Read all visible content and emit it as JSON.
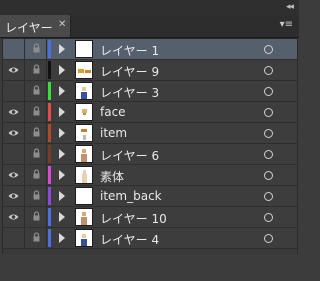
{
  "panel": {
    "collapse_glyph": "◂◂",
    "tab_label": "レイヤー",
    "close_glyph": "✕",
    "menu_glyph": "▾≡"
  },
  "layers": [
    {
      "name": "レイヤー 1",
      "visible": false,
      "color": "#4f6ee0",
      "selected": true,
      "thumb": "blank"
    },
    {
      "name": "レイヤー 9",
      "visible": true,
      "color": "#111111",
      "selected": false,
      "thumb": "objects"
    },
    {
      "name": "レイヤー 3",
      "visible": false,
      "color": "#3ddc3d",
      "selected": false,
      "thumb": "figure-blue"
    },
    {
      "name": "face",
      "visible": true,
      "color": "#e64a4a",
      "selected": false,
      "thumb": "face"
    },
    {
      "name": "item",
      "visible": true,
      "color": "#b04a2a",
      "selected": false,
      "thumb": "item"
    },
    {
      "name": "レイヤー 6",
      "visible": false,
      "color": "#7a3c2a",
      "selected": false,
      "thumb": "figure"
    },
    {
      "name": "素体",
      "visible": true,
      "color": "#d64ad6",
      "selected": false,
      "thumb": "body"
    },
    {
      "name": "item_back",
      "visible": true,
      "color": "#8a4ad6",
      "selected": false,
      "thumb": "blank"
    },
    {
      "name": "レイヤー 10",
      "visible": true,
      "color": "#4f6ee0",
      "selected": false,
      "thumb": "figure"
    },
    {
      "name": "レイヤー 4",
      "visible": false,
      "color": "#4f6ee0",
      "selected": false,
      "thumb": "figure-blue"
    }
  ]
}
